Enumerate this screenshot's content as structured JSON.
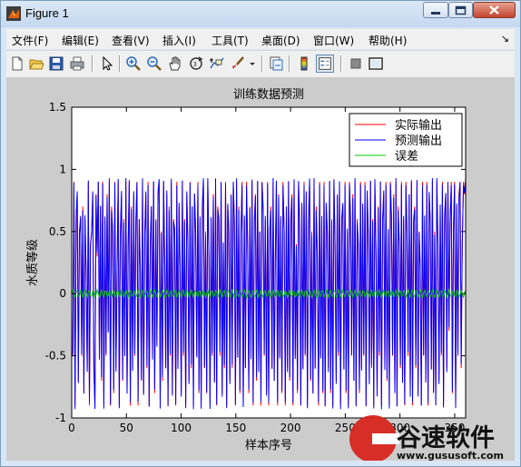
{
  "window": {
    "title": "Figure 1"
  },
  "menu": [
    "文件(F)",
    "编辑(E)",
    "查看(V)",
    "插入(I)",
    "工具(T)",
    "桌面(D)",
    "窗口(W)",
    "帮助(H)"
  ],
  "toolbar_icons": [
    "new-figure-icon",
    "open-file-icon",
    "save-icon",
    "print-icon",
    "pointer-icon",
    "zoom-in-icon",
    "zoom-out-icon",
    "pan-icon",
    "rotate-3d-icon",
    "data-cursor-icon",
    "brush-icon",
    "link-plot-icon",
    "colorbar-icon",
    "legend-icon",
    "hide-plot-tools-icon",
    "show-plot-tools-icon"
  ],
  "watermark": {
    "brand": "谷速软件",
    "url": "www.gususoft.com"
  },
  "colors": {
    "actual": "#ff0000",
    "predicted": "#0000ff",
    "error": "#00cc00"
  },
  "chart_data": {
    "type": "line",
    "title": "训练数据预测",
    "xlabel": "样本序号",
    "ylabel": "水质等级",
    "xlim": [
      0,
      360
    ],
    "ylim": [
      -1,
      1.5
    ],
    "xticks": [
      "0",
      "50",
      "100",
      "150",
      "200",
      "250",
      "300",
      "350"
    ],
    "yticks": [
      "-1",
      "-0.5",
      "0",
      "0.5",
      "1",
      "1.5"
    ],
    "legend_position": "top-right",
    "grid": false,
    "series": [
      {
        "name": "实际输出",
        "color": "#ff0000"
      },
      {
        "name": "预测输出",
        "color": "#0000ff"
      },
      {
        "name": "误差",
        "color": "#00cc00"
      }
    ],
    "actual_values": [
      -0.5,
      -0.5,
      0.9,
      -0.9,
      0.6,
      0.8,
      -0.7,
      0.5,
      0.6,
      -0.5,
      0.7,
      -0.8,
      0.6,
      0.2,
      -0.6,
      0.9,
      -0.9,
      0.4,
      0.5,
      0.8,
      -0.6,
      -0.9,
      0.8,
      0.3,
      0.9,
      -0.5,
      0.7,
      -0.7,
      0.9,
      -0.9,
      0.6,
      -0.5,
      0.8,
      -0.3,
      0.9,
      -0.9,
      0.7,
      0.5,
      -0.8,
      0.9,
      -0.6,
      0.2,
      0.9,
      -0.9,
      0.5,
      0.8,
      -0.7,
      0.6,
      -0.5,
      0.9,
      -0.8,
      0.4,
      0.9,
      -0.9,
      0.7,
      -0.6,
      0.8,
      -0.5,
      0.6,
      0.9,
      -0.9,
      0.6,
      0.2,
      -0.7,
      0.9,
      -0.8,
      0.5,
      0.8,
      -0.6,
      0.9,
      -0.9,
      0.4,
      0.7,
      -0.5,
      0.9,
      -0.8,
      0.6,
      -0.4,
      0.8,
      0.9,
      -0.9,
      0.5,
      -0.7,
      0.9,
      0.3,
      -0.6,
      0.8,
      -0.9,
      0.7,
      -0.5,
      0.9,
      -0.8,
      0.6,
      0.5,
      -0.9,
      0.9,
      -0.6,
      0.7,
      0.2,
      -0.8,
      0.9,
      -0.5,
      0.6,
      -0.9,
      0.8,
      0.4,
      -0.7,
      0.9,
      -0.6,
      0.7,
      -0.9,
      0.8,
      0.5,
      -0.5,
      0.9,
      -0.8,
      0.6,
      -0.9,
      0.7,
      0.9,
      -0.6,
      0.5,
      -0.8,
      0.9,
      0.3,
      -0.9,
      0.6,
      -0.5,
      0.8,
      -0.7,
      0.9,
      -0.9,
      0.7,
      0.6,
      -0.5,
      0.9,
      -0.8,
      0.4,
      -0.6,
      0.9,
      -0.9,
      0.7,
      0.5,
      -0.7,
      0.8,
      -0.6,
      0.9,
      0.6,
      -0.9,
      0.9,
      -0.5,
      0.7,
      -0.8,
      0.5,
      0.9,
      -0.9,
      0.6,
      -0.6,
      0.9,
      0.4,
      -0.8,
      0.7,
      -0.5,
      0.9,
      -0.9,
      0.6,
      0.8,
      -0.7,
      0.9,
      -0.6,
      0.5,
      -0.9,
      0.9,
      0.7,
      -0.5,
      0.6,
      -0.8,
      0.9,
      -0.9,
      0.5,
      0.7,
      -0.6,
      0.9,
      -0.7,
      0.3,
      0.9,
      -0.9,
      0.8,
      -0.5,
      0.6,
      -0.8,
      0.9,
      0.5,
      -0.9,
      0.7,
      -0.6,
      0.9,
      -0.7,
      0.6,
      0.8,
      -0.9,
      0.9,
      -0.5,
      0.4,
      -0.8,
      0.9,
      0.6,
      -0.9,
      0.7,
      -0.6,
      0.9,
      -0.5,
      0.8,
      -0.9,
      0.6,
      0.9,
      -0.7,
      0.5,
      -0.8,
      0.9,
      -0.6,
      0.7,
      0.3,
      -0.9,
      0.9,
      -0.5,
      0.6,
      -0.8,
      0.9,
      -0.9,
      0.7,
      0.5,
      -0.6,
      0.9,
      -0.8,
      0.6,
      -0.9,
      0.9,
      0.4,
      -0.7,
      0.8,
      -0.5,
      0.9,
      -0.9,
      0.6,
      0.7,
      -0.6,
      0.9,
      -0.8,
      0.5,
      -0.9,
      0.9,
      0.6,
      -0.5,
      0.8,
      -0.7,
      0.9,
      -0.9,
      0.6,
      0.4,
      -0.8,
      0.9,
      -0.6,
      0.7,
      -0.5,
      0.9,
      -0.9,
      0.8,
      0.5,
      -0.7,
      0.9,
      -0.6,
      0.6,
      -0.9,
      0.9,
      0.3,
      -0.8,
      0.7,
      -0.5,
      0.9,
      -0.9,
      0.6,
      0.8,
      -0.6,
      0.9,
      -0.7,
      0.5,
      -0.9,
      0.9,
      0.6,
      -0.5,
      0.8,
      -0.8,
      0.9,
      -0.9,
      0.7,
      0.4,
      -0.6,
      0.9,
      -0.7,
      0.6,
      -0.9,
      0.9,
      0.5,
      -0.5,
      0.8,
      -0.8,
      0.9,
      -0.9,
      0.6,
      0.7,
      -0.6,
      0.9,
      -0.8,
      0.5,
      0.2,
      -0.9,
      0.9,
      -0.5,
      0.6,
      -0.7,
      0.9,
      -0.9,
      0.8,
      0.6,
      -0.6,
      0.9,
      -0.8,
      0.5,
      -0.9,
      0.9,
      0.4,
      -0.7,
      0.7,
      -0.5,
      0.9,
      -0.9,
      0.6,
      0.8,
      -0.6,
      0.9,
      -0.3,
      0.6,
      0.9,
      -0.8,
      0.5,
      0.9,
      -0.9,
      0.7,
      -0.5,
      0.8,
      0.9,
      -0.6,
      0.4,
      0.9,
      0.8,
      0.9
    ]
  }
}
